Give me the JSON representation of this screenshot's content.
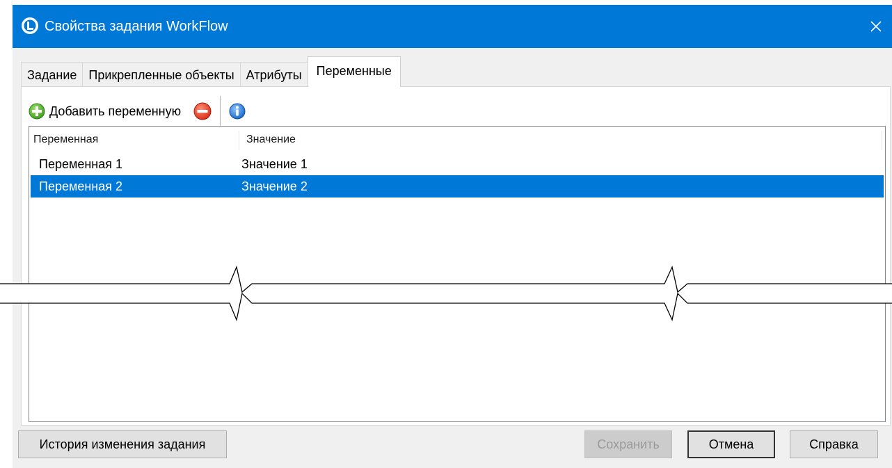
{
  "window": {
    "title": "Свойства задания WorkFlow",
    "close_glyph": "✕",
    "accent_color": "#0078d7"
  },
  "tabs": [
    {
      "label": "Задание",
      "active": false
    },
    {
      "label": "Прикрепленные объекты",
      "active": false
    },
    {
      "label": "Атрибуты",
      "active": false
    },
    {
      "label": "Переменные",
      "active": true
    }
  ],
  "toolbar": {
    "add_label": "Добавить переменную",
    "add_icon": "plus-circle-green-icon",
    "remove_icon": "minus-circle-red-icon",
    "info_icon": "info-circle-blue-icon"
  },
  "table": {
    "columns": [
      "Переменная",
      "Значение"
    ],
    "rows": [
      {
        "variable": "Переменная 1",
        "value": "Значение 1",
        "selected": false
      },
      {
        "variable": "Переменная 2",
        "value": "Значение 2",
        "selected": true
      }
    ],
    "selection_color": "#0078d7"
  },
  "footer": {
    "history_label": "История изменения задания",
    "save_label": "Сохранить",
    "save_disabled": true,
    "cancel_label": "Отмена",
    "help_label": "Справка"
  }
}
